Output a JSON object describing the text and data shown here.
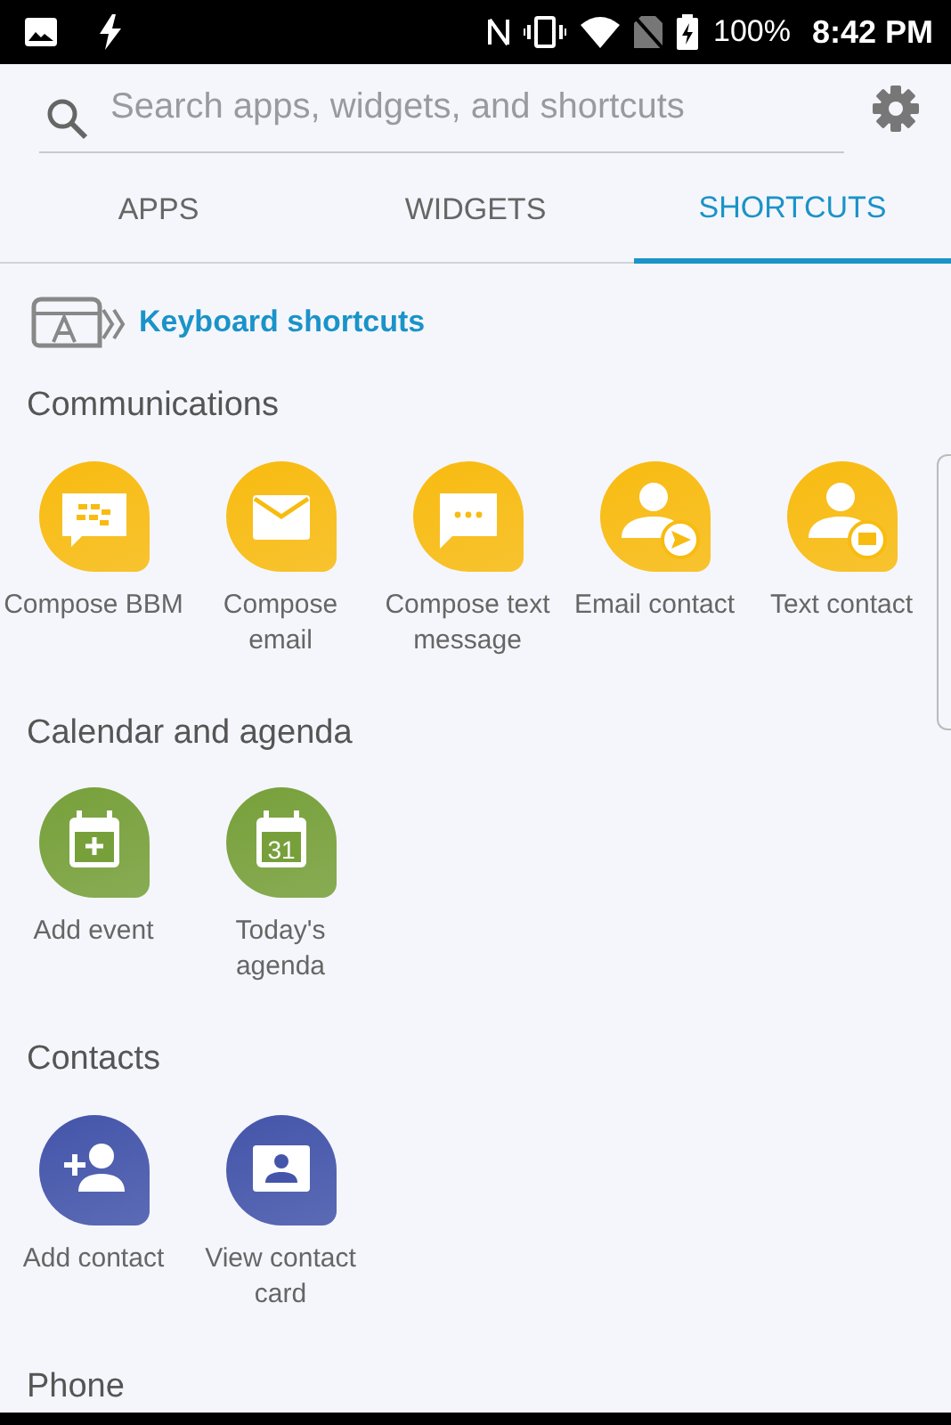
{
  "status_bar": {
    "battery_text": "100%",
    "time": "8:42 PM"
  },
  "search": {
    "placeholder": "Search apps, widgets, and shortcuts"
  },
  "tabs": [
    {
      "label": "APPS",
      "selected": false
    },
    {
      "label": "WIDGETS",
      "selected": false
    },
    {
      "label": "SHORTCUTS",
      "selected": true
    }
  ],
  "keyboard_shortcuts": {
    "label": "Keyboard shortcuts"
  },
  "sections": [
    {
      "title": "Communications",
      "color": "#f8bb10",
      "items": [
        {
          "label": "Compose BBM",
          "kind": "bbm"
        },
        {
          "label": "Compose email",
          "kind": "email"
        },
        {
          "label": "Compose text message",
          "kind": "message"
        },
        {
          "label": "Email contact",
          "kind": "email-contact"
        },
        {
          "label": "Text contact",
          "kind": "text-contact"
        }
      ]
    },
    {
      "title": "Calendar and agenda",
      "color": "#77a03a",
      "items": [
        {
          "label": "Add event",
          "kind": "add-event"
        },
        {
          "label": "Today's agenda",
          "kind": "agenda",
          "icon_text": "31"
        }
      ]
    },
    {
      "title": "Contacts",
      "color": "#4455aa",
      "items": [
        {
          "label": "Add contact",
          "kind": "add-contact"
        },
        {
          "label": "View contact card",
          "kind": "contact-card"
        }
      ]
    },
    {
      "title": "Phone"
    }
  ]
}
